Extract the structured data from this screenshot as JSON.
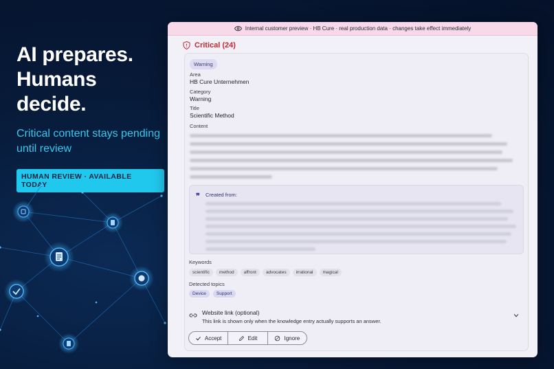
{
  "hero": {
    "title_line1": "AI prepares.",
    "title_line2": "Humans decide.",
    "subtitle": "Critical content stays pending until review",
    "badge": "HUMAN REVIEW · AVAILABLE TODAY"
  },
  "banner": {
    "icon": "eye-icon",
    "text": "Internal customer preview · HB Cure · real production data · changes take effect immediately"
  },
  "critical": {
    "icon": "shield-icon",
    "title": "Critical (24)"
  },
  "entry": {
    "badge": "Warning",
    "area_label": "Area",
    "area_value": "HB Cure Unternehmen",
    "category_label": "Category",
    "category_value": "Warning",
    "title_label": "Title",
    "title_value": "Scientific Method",
    "content_label": "Content",
    "created_from_label": "Created from:",
    "keywords_label": "Keywords",
    "keywords": [
      "scientific",
      "method",
      "affront",
      "advocates",
      "irrational",
      "magical"
    ],
    "topics_label": "Detected topics",
    "topics": [
      "Device",
      "Support"
    ],
    "link_title": "Website link (optional)",
    "link_desc": "This link is shown only when the knowledge entry actually supports an answer."
  },
  "actions": {
    "accept": "Accept",
    "edit": "Edit",
    "ignore": "Ignore"
  },
  "colors": {
    "critical": "#c3262f",
    "accent_cyan": "#21c8ee",
    "banner_bg": "#f7d9ea"
  }
}
